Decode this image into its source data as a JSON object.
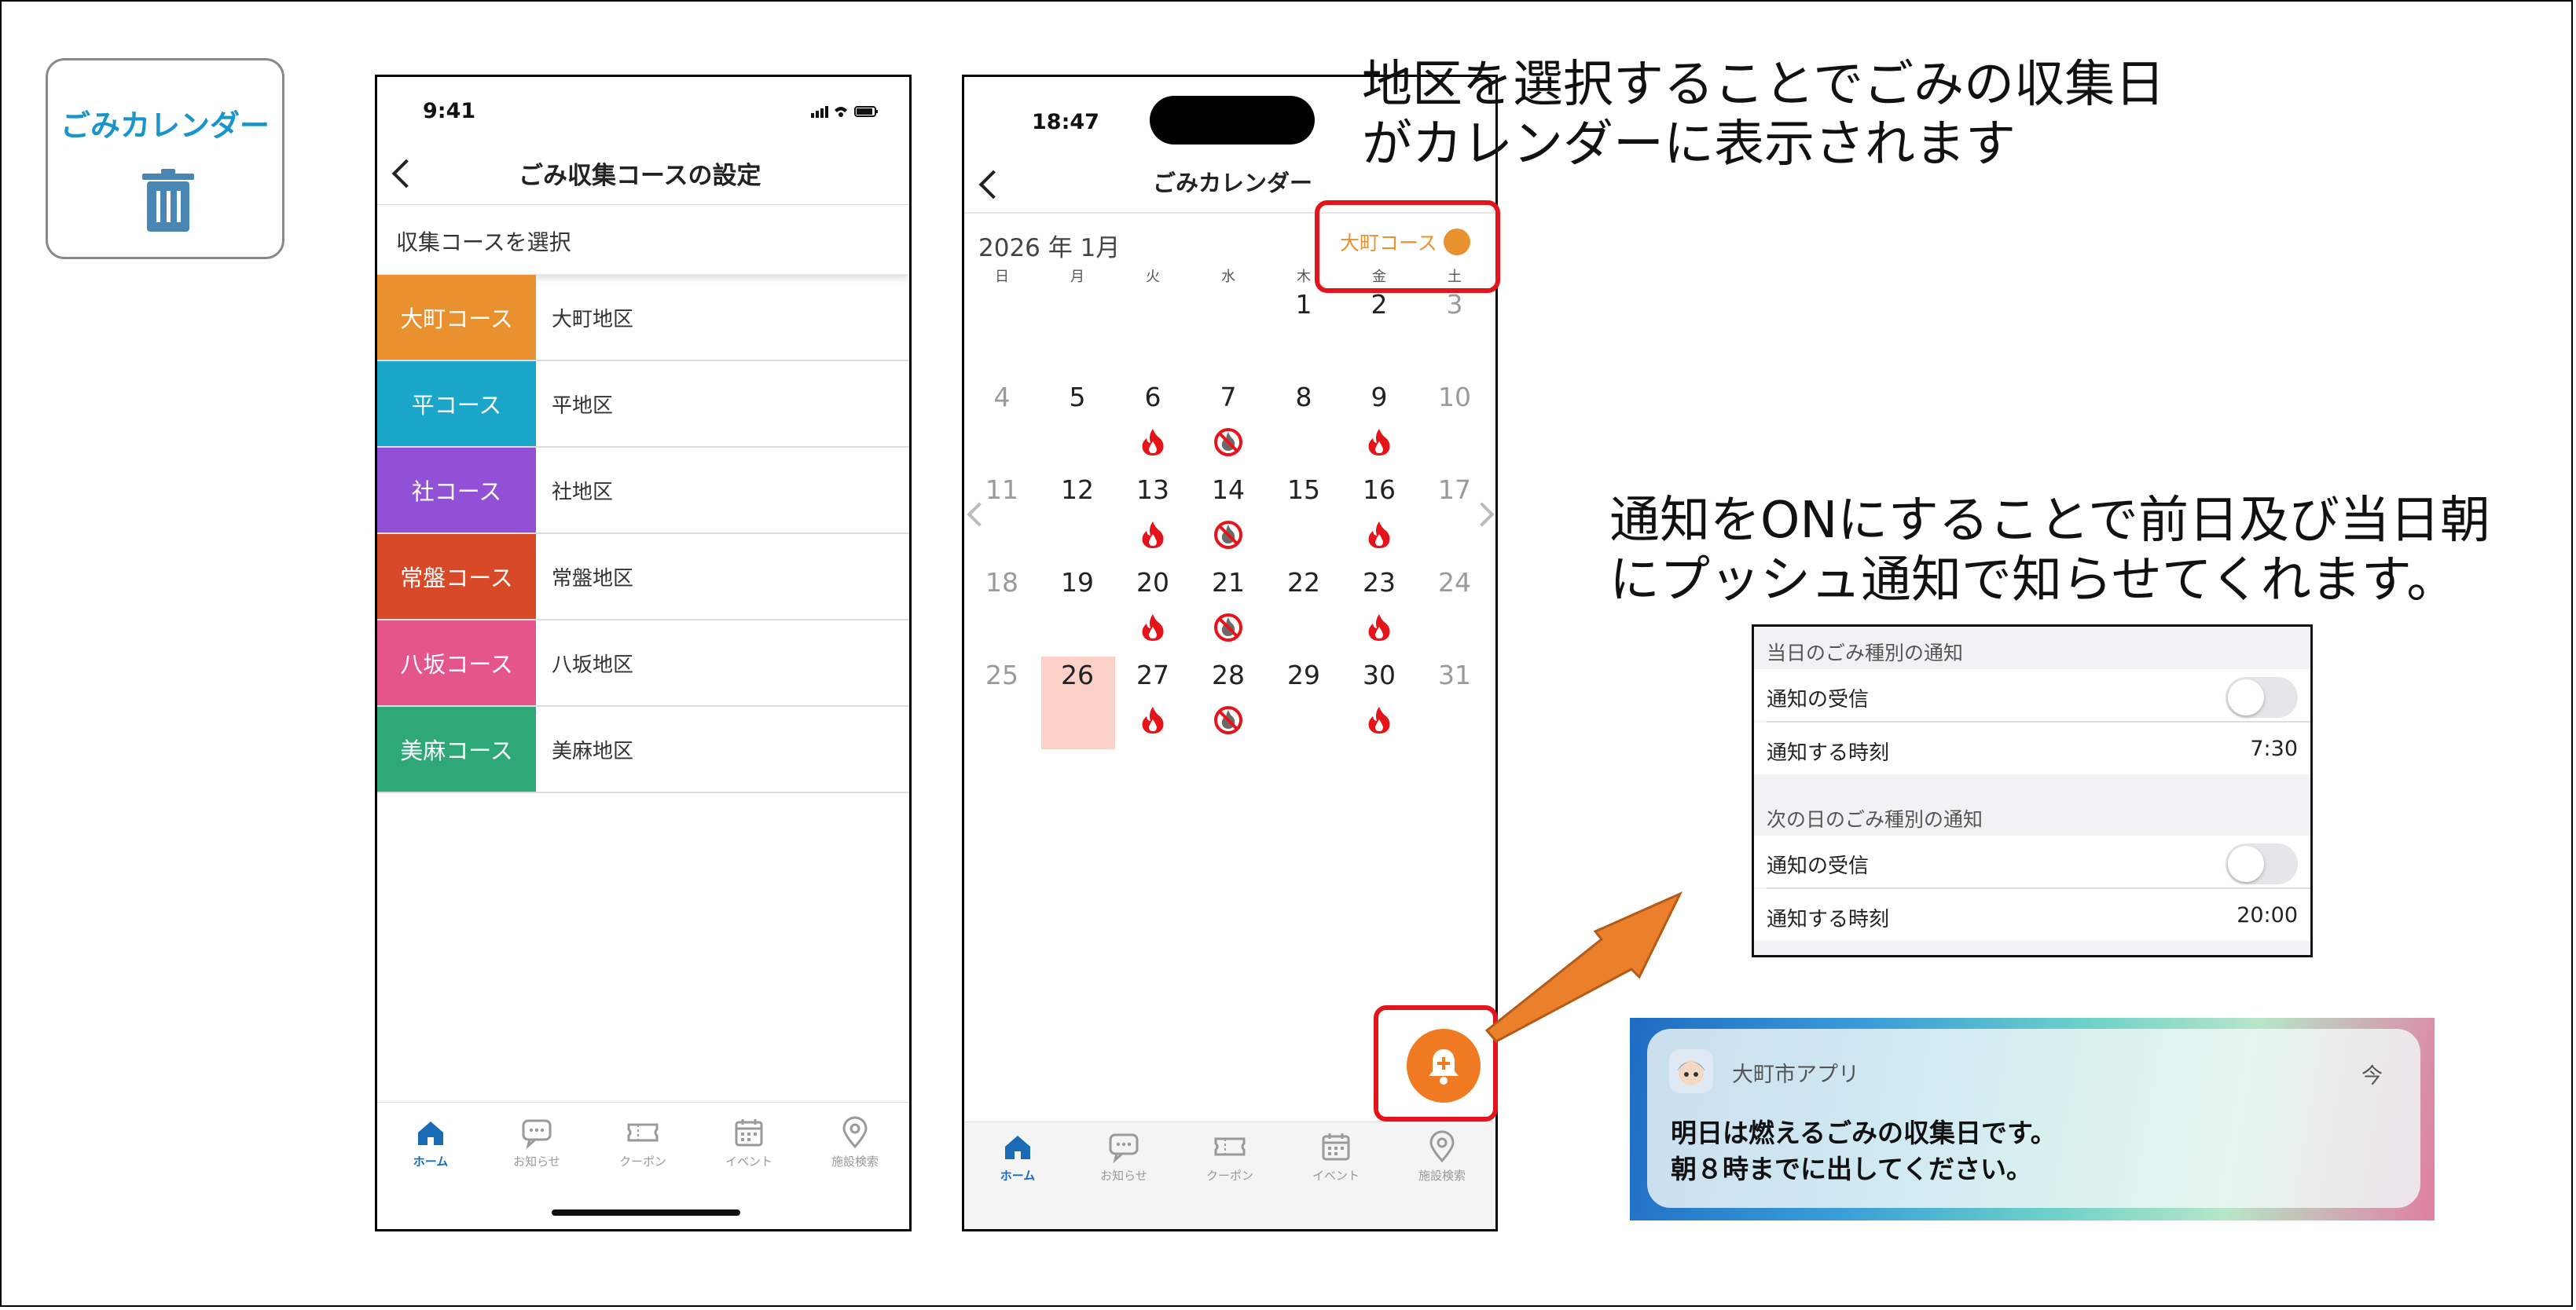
{
  "app_card": {
    "label": "ごみカレンダー",
    "icon": "trash-can-icon"
  },
  "phone1": {
    "status_time": "9:41",
    "title": "ごみ収集コースの設定",
    "section_header": "収集コースを選択",
    "courses": [
      {
        "name": "大町コース",
        "area": "大町地区",
        "color": "#e8912e"
      },
      {
        "name": "平コース",
        "area": "平地区",
        "color": "#1aa6c8"
      },
      {
        "name": "社コース",
        "area": "社地区",
        "color": "#9150d6"
      },
      {
        "name": "常盤コース",
        "area": "常盤地区",
        "color": "#d84a27"
      },
      {
        "name": "八坂コース",
        "area": "八坂地区",
        "color": "#e4558c"
      },
      {
        "name": "美麻コース",
        "area": "美麻地区",
        "color": "#2ea877"
      }
    ]
  },
  "tabs": [
    {
      "label": "ホーム",
      "icon": "home-icon"
    },
    {
      "label": "お知らせ",
      "icon": "chat-bubble-icon"
    },
    {
      "label": "クーポン",
      "icon": "ticket-icon"
    },
    {
      "label": "イベント",
      "icon": "calendar-icon"
    },
    {
      "label": "施設検索",
      "icon": "map-pin-icon"
    }
  ],
  "phone2": {
    "status_time": "18:47",
    "title": "ごみカレンダー",
    "month": "2026 年 1月",
    "course_label": "大町コース",
    "course_color": "#e8912e",
    "weekdays": [
      "日",
      "月",
      "火",
      "水",
      "木",
      "金",
      "土"
    ],
    "today": 26,
    "days": [
      [
        null,
        null,
        null,
        null,
        1,
        2,
        3
      ],
      [
        4,
        5,
        6,
        7,
        8,
        9,
        10
      ],
      [
        11,
        12,
        13,
        14,
        15,
        16,
        17
      ],
      [
        18,
        19,
        20,
        21,
        22,
        23,
        24
      ],
      [
        25,
        26,
        27,
        28,
        29,
        30,
        31
      ]
    ],
    "burnable_days": [
      6,
      9,
      13,
      16,
      20,
      23,
      27,
      30
    ],
    "nonburnable_days": [
      7,
      14,
      21,
      28
    ]
  },
  "note_top": {
    "line1": "地区を選択することでごみの収集日",
    "line2": "がカレンダーに表示されます"
  },
  "note_mid": {
    "line1": "通知をONにすることで前日及び当日朝",
    "line2": "にプッシュ通知で知らせてくれます。"
  },
  "settings": {
    "section1": {
      "header": "当日のごみ種別の通知",
      "receive_label": "通知の受信",
      "time_label": "通知する時刻",
      "time_value": "7:30",
      "enabled": false
    },
    "section2": {
      "header": "次の日のごみ種別の通知",
      "receive_label": "通知の受信",
      "time_label": "通知する時刻",
      "time_value": "20:00",
      "enabled": false
    }
  },
  "notification": {
    "app_name": "大町市アプリ",
    "time": "今",
    "line1": "明日は燃えるごみの収集日です。",
    "line2": "朝８時までに出してください。"
  },
  "colors": {
    "highlight": "#e5141b",
    "accent_orange": "#f07a22",
    "active_tab": "#1a6bb5",
    "today_bg": "#fbd1c8",
    "flame": "#e5141b"
  }
}
